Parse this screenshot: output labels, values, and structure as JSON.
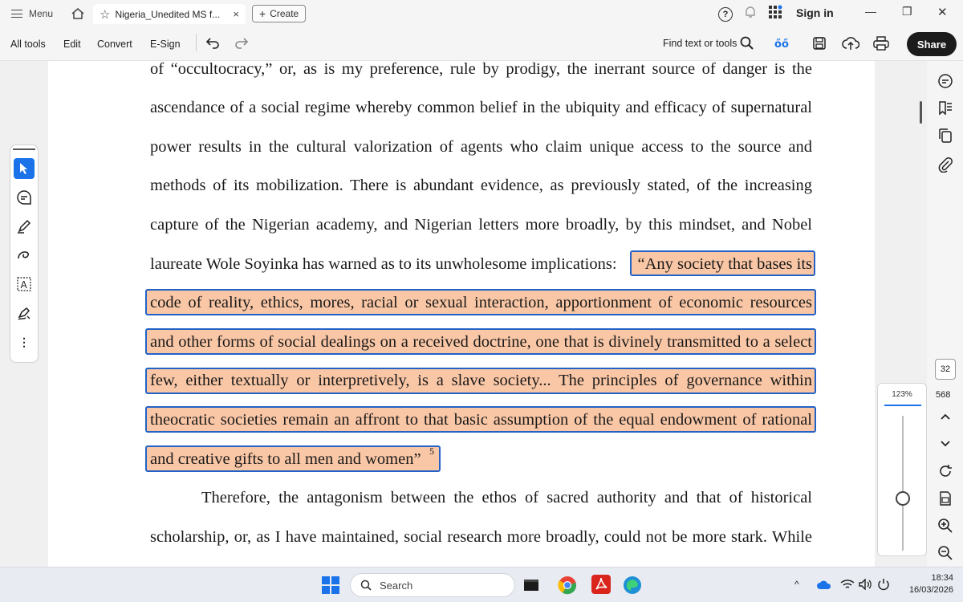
{
  "titlebar": {
    "menu_label": "Menu",
    "tab_title": "Nigeria_Unedited MS f...",
    "tab_close": "×",
    "create_label": "Create",
    "help": "?",
    "sign_in": "Sign in",
    "minimize": "—",
    "maximize": "❐",
    "close": "✕"
  },
  "toolbar": {
    "all_tools": "All tools",
    "edit": "Edit",
    "convert": "Convert",
    "esign": "E-Sign",
    "find": "Find text or tools",
    "share": "Share"
  },
  "document": {
    "lines": [
      "of “occultocracy,” or, as is my preference, rule by prodigy, the inerrant source of danger is the",
      "ascendance of a social regime whereby common belief in the ubiquity and efficacy of supernatural",
      "power results in the cultural valorization of agents who claim unique access to the source and",
      "methods of its mobilization. There is abundant evidence, as previously stated, of the increasing",
      "capture of the Nigerian academy, and Nigerian letters more broadly, by this mindset, and Nobel",
      "laureate Wole Soyinka has warned as to its unwholesome implications:",
      "“Any society that bases its",
      "code of reality, ethics, mores, racial or sexual interaction, apportionment of economic resources",
      "and other forms of social dealings on a received doctrine, one that is divinely transmitted to a select",
      "few, either textually or interpretively, is a slave society... The principles of governance within",
      "theocratic societies remain an affront to that basic assumption of the equal endowment of rational",
      "and creative gifts to all men and women”",
      "5",
      "Therefore, the antagonism between the ethos of sacred authority and that of historical",
      "scholarship, or, as I have maintained, social research more broadly, could not be more stark. While"
    ]
  },
  "zoom": {
    "percent": "123%"
  },
  "pages": {
    "current": "32",
    "total": "568"
  },
  "taskbar": {
    "search_placeholder": "Search",
    "time": "18:34",
    "date": "16/03/2026"
  },
  "colors": {
    "highlight": "#fac7a6",
    "selection_border": "#2262c6",
    "accent": "#1a73e8",
    "share_bg": "#1b1b1b"
  }
}
